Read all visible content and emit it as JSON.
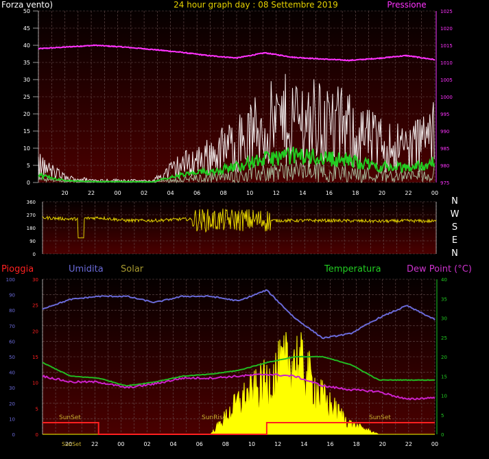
{
  "header": {
    "left_label": "Forza vento)",
    "title": "24 hour graph day : 08 Settembre 2019",
    "right_label": "Pressione"
  },
  "wind_panel": {
    "left_ticks": [
      "50",
      "45",
      "40",
      "35",
      "30",
      "25",
      "20",
      "15",
      "10",
      "5",
      "0"
    ],
    "right_ticks": [
      "1025",
      "1020",
      "1015",
      "1010",
      "1005",
      "1000",
      "995",
      "990",
      "985",
      "980",
      "975"
    ]
  },
  "direction_panel": {
    "ticks": [
      "360",
      "270",
      "180",
      "90",
      "0"
    ],
    "compass": [
      "N",
      "W",
      "S",
      "E",
      "N"
    ]
  },
  "weather_panel": {
    "legend": {
      "rain": "Pioggia",
      "humidity": "Umidita",
      "solar": "Solar",
      "temperature": "Temperatura",
      "dewpoint": "Dew Point (°C)"
    },
    "humidity_ticks": [
      "100",
      "90",
      "80",
      "70",
      "60",
      "50",
      "40",
      "30",
      "20",
      "10",
      "0"
    ],
    "rain_ticks": [
      "30",
      "25",
      "20",
      "15",
      "10",
      "5",
      "0"
    ],
    "temp_ticks": [
      "40",
      "35",
      "30",
      "25",
      "20",
      "15",
      "10",
      "5",
      "0"
    ],
    "annotations": {
      "sunset_1": "SunSet",
      "sunrise": "SunRise",
      "sunset_2": "SunSet",
      "sunset_overlap": "SunSet"
    }
  },
  "time_labels": [
    "20",
    "22",
    "00",
    "02",
    "04",
    "06",
    "08",
    "10",
    "12",
    "14",
    "16",
    "18",
    "20",
    "22",
    "00"
  ],
  "colors": {
    "pressure": "#ff33ff",
    "wind_gust": "#f5f0f0",
    "wind_avg": "#22cc22",
    "direction": "#e0d000",
    "humidity": "#6a6ad8",
    "temperature": "#22bb22",
    "dewpoint": "#cc22cc",
    "solar": "#ffff00",
    "rain": "#ff2020",
    "header_text": "#e6d200",
    "axis_text": "#ffffff"
  },
  "chart_data": [
    {
      "type": "line",
      "title": "24 hour graph day : 08 Settembre 2019",
      "x": [
        "20",
        "22",
        "00",
        "02",
        "04",
        "06",
        "08",
        "10",
        "12",
        "14",
        "16",
        "18",
        "20",
        "22",
        "00"
      ],
      "ylim": [
        0,
        50
      ],
      "y2lim": [
        975,
        1025
      ],
      "series": [
        {
          "name": "Pressione",
          "axis": "right",
          "values": [
            1014,
            1014.5,
            1015,
            1014.5,
            1013.8,
            1013,
            1012,
            1011.3,
            1012.8,
            1011.5,
            1011,
            1010.6,
            1011.2,
            1012,
            1010.8
          ]
        },
        {
          "name": "Forza vento)",
          "values": [
            4,
            1,
            0.5,
            0.5,
            0.3,
            4,
            6,
            9,
            13,
            15,
            14,
            12,
            9,
            8,
            11
          ]
        }
      ]
    },
    {
      "type": "scatter",
      "ylim": [
        0,
        360
      ],
      "series": [
        {
          "values": [
            250,
            240,
            250,
            230,
            230,
            240,
            230,
            235,
            230,
            230,
            230,
            228,
            225,
            228,
            225
          ]
        }
      ]
    },
    {
      "type": "line",
      "title": "",
      "x": [
        "20",
        "22",
        "00",
        "02",
        "04",
        "06",
        "08",
        "10",
        "12",
        "14",
        "16",
        "18",
        "20",
        "22",
        "00"
      ],
      "ylim": [
        0,
        100
      ],
      "y2lim": [
        0,
        40
      ],
      "series": [
        {
          "name": "Umidita",
          "values": [
            81,
            87,
            89,
            89,
            85,
            89,
            89,
            86,
            93,
            75,
            62,
            65,
            75,
            83,
            74
          ]
        },
        {
          "name": "Temperatura",
          "axis": "right",
          "values": [
            18.5,
            15,
            14.5,
            12.5,
            13.5,
            15,
            15.5,
            16.5,
            18.5,
            20,
            20,
            18,
            14,
            14,
            14
          ]
        },
        {
          "name": "Dew Point (°C)",
          "axis": "right",
          "values": [
            15,
            13.5,
            13.5,
            12,
            13,
            14.5,
            14.5,
            15,
            15.5,
            15,
            12.5,
            11.5,
            11,
            9,
            9.5
          ]
        },
        {
          "name": "Solar",
          "values": [
            0,
            0,
            0,
            0,
            0,
            0,
            0,
            25,
            40,
            60,
            28,
            8,
            0,
            0,
            0
          ]
        },
        {
          "name": "Pioggia",
          "values": [
            3,
            3,
            0,
            0,
            0,
            0,
            0,
            0,
            3,
            3,
            3,
            3,
            3,
            3,
            3
          ]
        }
      ]
    }
  ]
}
